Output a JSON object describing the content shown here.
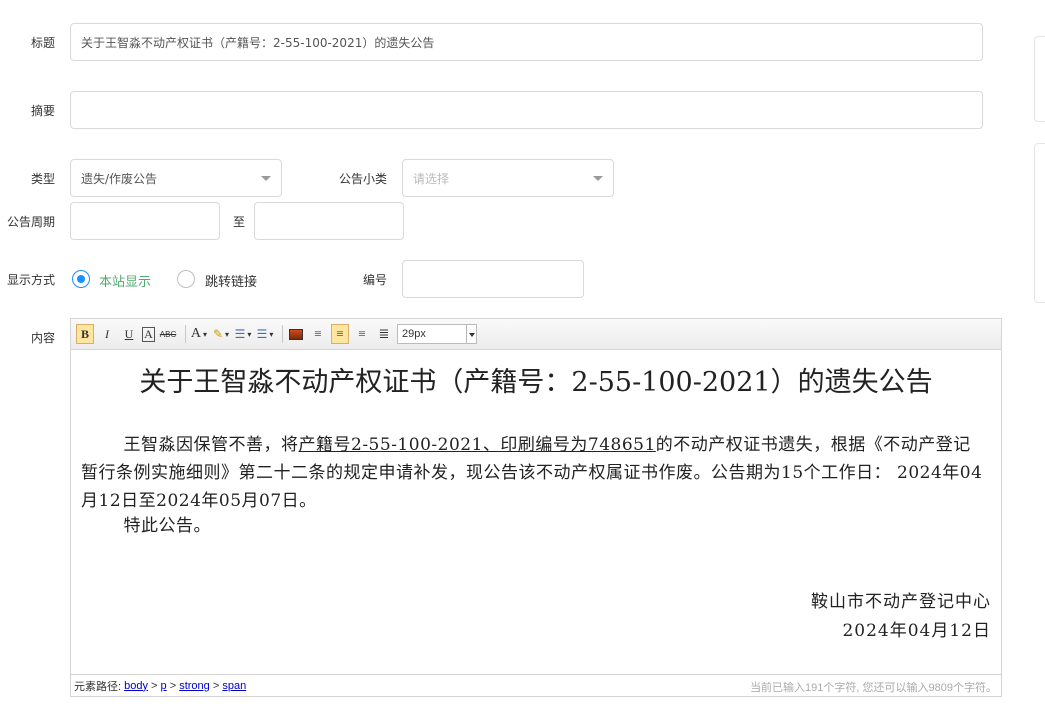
{
  "form": {
    "title_label": "标题",
    "title_value": "关于王智淼不动产权证书（产籍号：2-55-100-2021）的遗失公告",
    "summary_label": "摘要",
    "summary_value": "",
    "type_label": "类型",
    "type_value": "遗失/作废公告",
    "subtype_label": "公告小类",
    "subtype_placeholder": "请选择",
    "period_label": "公告周期",
    "period_to": "至",
    "display_label": "显示方式",
    "display_options": [
      "本站显示",
      "跳转链接"
    ],
    "display_selected": "本站显示",
    "number_label": "编号",
    "content_label": "内容"
  },
  "editor": {
    "font_size": "29px",
    "toolbar_glyphs": {
      "bold": "B",
      "italic": "I",
      "underline": "U",
      "border": "A",
      "strike": "ABC",
      "font_color": "A"
    },
    "doc_title": "关于王智淼不动产权证书（产籍号：2-55-100-2021）的遗失公告",
    "body_before": "王智淼因保管不善，将",
    "body_underlined": "产籍号2-55-100-2021、印刷编号为748651",
    "body_after": "的不动产权证书遗失，根据《不动产登记暂行条例实施细则》第二十二条的规定申请补发，现公告该不动产权属证书作废。公告期为15个工作日：  2024年04月12日至2024年05月07日。",
    "closing": "特此公告。",
    "org": "鞍山市不动产登记中心",
    "date": "2024年04月12日",
    "path_label": "元素路径:",
    "path": [
      "body",
      "p",
      "strong",
      "span"
    ],
    "counter": "当前已输入191个字符, 您还可以输入9809个字符。"
  },
  "colors": {
    "accent": "#1890ff",
    "active_green": "#52a86f"
  }
}
